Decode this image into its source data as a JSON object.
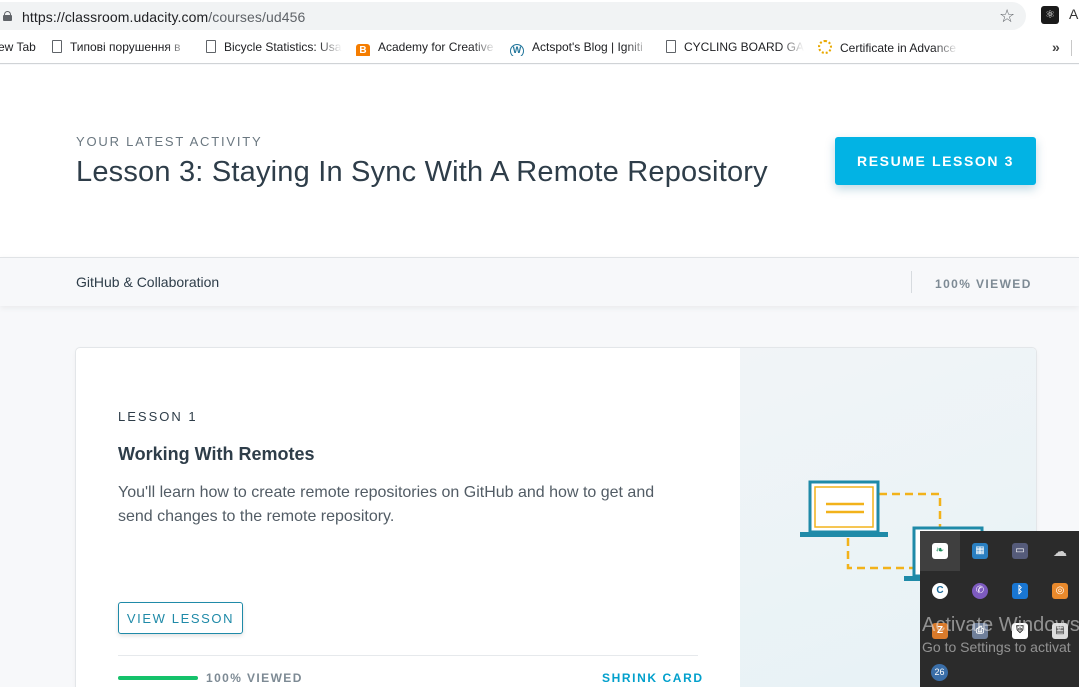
{
  "browser": {
    "url_host": "https://classroom.udacity.com",
    "url_path": "/courses/ud456",
    "bookmarks": [
      {
        "label": "ew Tab",
        "icon": "none"
      },
      {
        "label": "Типові порушення в",
        "icon": "document-icon"
      },
      {
        "label": "Bicycle Statistics: Usa",
        "icon": "document-icon"
      },
      {
        "label": "Academy for Creative",
        "icon": "blogger-icon"
      },
      {
        "label": "Actspot's Blog | Igniti",
        "icon": "wordpress-icon"
      },
      {
        "label": "CYCLING BOARD GAI",
        "icon": "document-icon"
      },
      {
        "label": "Certificate in Advance",
        "icon": "sun-icon"
      }
    ],
    "more_bookmarks": "»"
  },
  "hero": {
    "eyebrow": "YOUR LATEST ACTIVITY",
    "title": "Lesson 3: Staying In Sync With A Remote Repository",
    "resume_label": "RESUME LESSON 3"
  },
  "course_bar": {
    "title": "GitHub & Collaboration",
    "viewed": "100% VIEWED"
  },
  "lesson_card": {
    "number": "LESSON 1",
    "title": "Working With Remotes",
    "description": "You'll learn how to create remote repositories on GitHub and how to get and send changes to the remote repository.",
    "view_label": "VIEW LESSON",
    "progress": 1.0,
    "viewed": "100% VIEWED",
    "shrink_label": "SHRINK CARD"
  },
  "tray_overlay": {
    "watermark_title": "Activate Windows",
    "watermark_sub": "Go to Settings to activat",
    "badge": "26"
  },
  "colors": {
    "accent": "#02b3e4",
    "progress": "#15c26b",
    "text": "#2e3d49",
    "illustration_teal": "#1f8aa8",
    "illustration_gold": "#f2b21a"
  }
}
